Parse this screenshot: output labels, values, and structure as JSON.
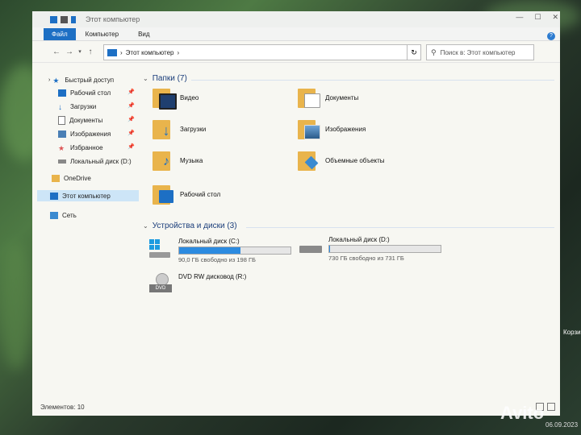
{
  "window": {
    "title": "Этот компьютер"
  },
  "ribbon": {
    "file": "Файл",
    "tabs": [
      "Компьютер",
      "Вид"
    ]
  },
  "address": {
    "path": "Этот компьютер",
    "separator": "›"
  },
  "search": {
    "placeholder": "Поиск в: Этот компьютер"
  },
  "sidebar": {
    "quick_access": "Быстрый доступ",
    "items": [
      {
        "label": "Рабочий стол",
        "pinned": true,
        "icon": "desktop-icon"
      },
      {
        "label": "Загрузки",
        "pinned": true,
        "icon": "download-icon"
      },
      {
        "label": "Документы",
        "pinned": true,
        "icon": "document-icon"
      },
      {
        "label": "Изображения",
        "pinned": true,
        "icon": "pictures-icon"
      },
      {
        "label": "Избранное",
        "pinned": true,
        "icon": "star-icon"
      },
      {
        "label": "Локальный диск (D:)",
        "pinned": false,
        "icon": "drive-icon"
      }
    ],
    "onedrive": "OneDrive",
    "this_pc": "Этот компьютер",
    "network": "Сеть"
  },
  "folders_group": {
    "title": "Папки (7)"
  },
  "folders": [
    {
      "label": "Видео",
      "icon": "video-folder-icon"
    },
    {
      "label": "Документы",
      "icon": "documents-folder-icon"
    },
    {
      "label": "Загрузки",
      "icon": "downloads-folder-icon"
    },
    {
      "label": "Изображения",
      "icon": "pictures-folder-icon"
    },
    {
      "label": "Музыка",
      "icon": "music-folder-icon"
    },
    {
      "label": "Объемные объекты",
      "icon": "3d-objects-folder-icon"
    },
    {
      "label": "Рабочий стол",
      "icon": "desktop-folder-icon"
    }
  ],
  "drives_group": {
    "title": "Устройства и диски (3)"
  },
  "drives": [
    {
      "label": "Локальный диск (C:)",
      "free": "90,0 ГБ свободно из 198 ГБ",
      "used_fraction": 0.55,
      "icon": "windows-drive-icon"
    },
    {
      "label": "Локальный диск (D:)",
      "free": "730 ГБ свободно из 731 ГБ",
      "used_fraction": 0.01,
      "icon": "drive-icon"
    },
    {
      "label": "DVD RW дисковод (R:)",
      "icon": "dvd-drive-icon"
    }
  ],
  "status": {
    "items": "Элементов: 10"
  },
  "desktop": {
    "recycle": "Корзина",
    "watermark": "Avito",
    "date": "06.09.2023"
  },
  "colors": {
    "accent": "#1d6fc4",
    "folder": "#e9b44c"
  }
}
